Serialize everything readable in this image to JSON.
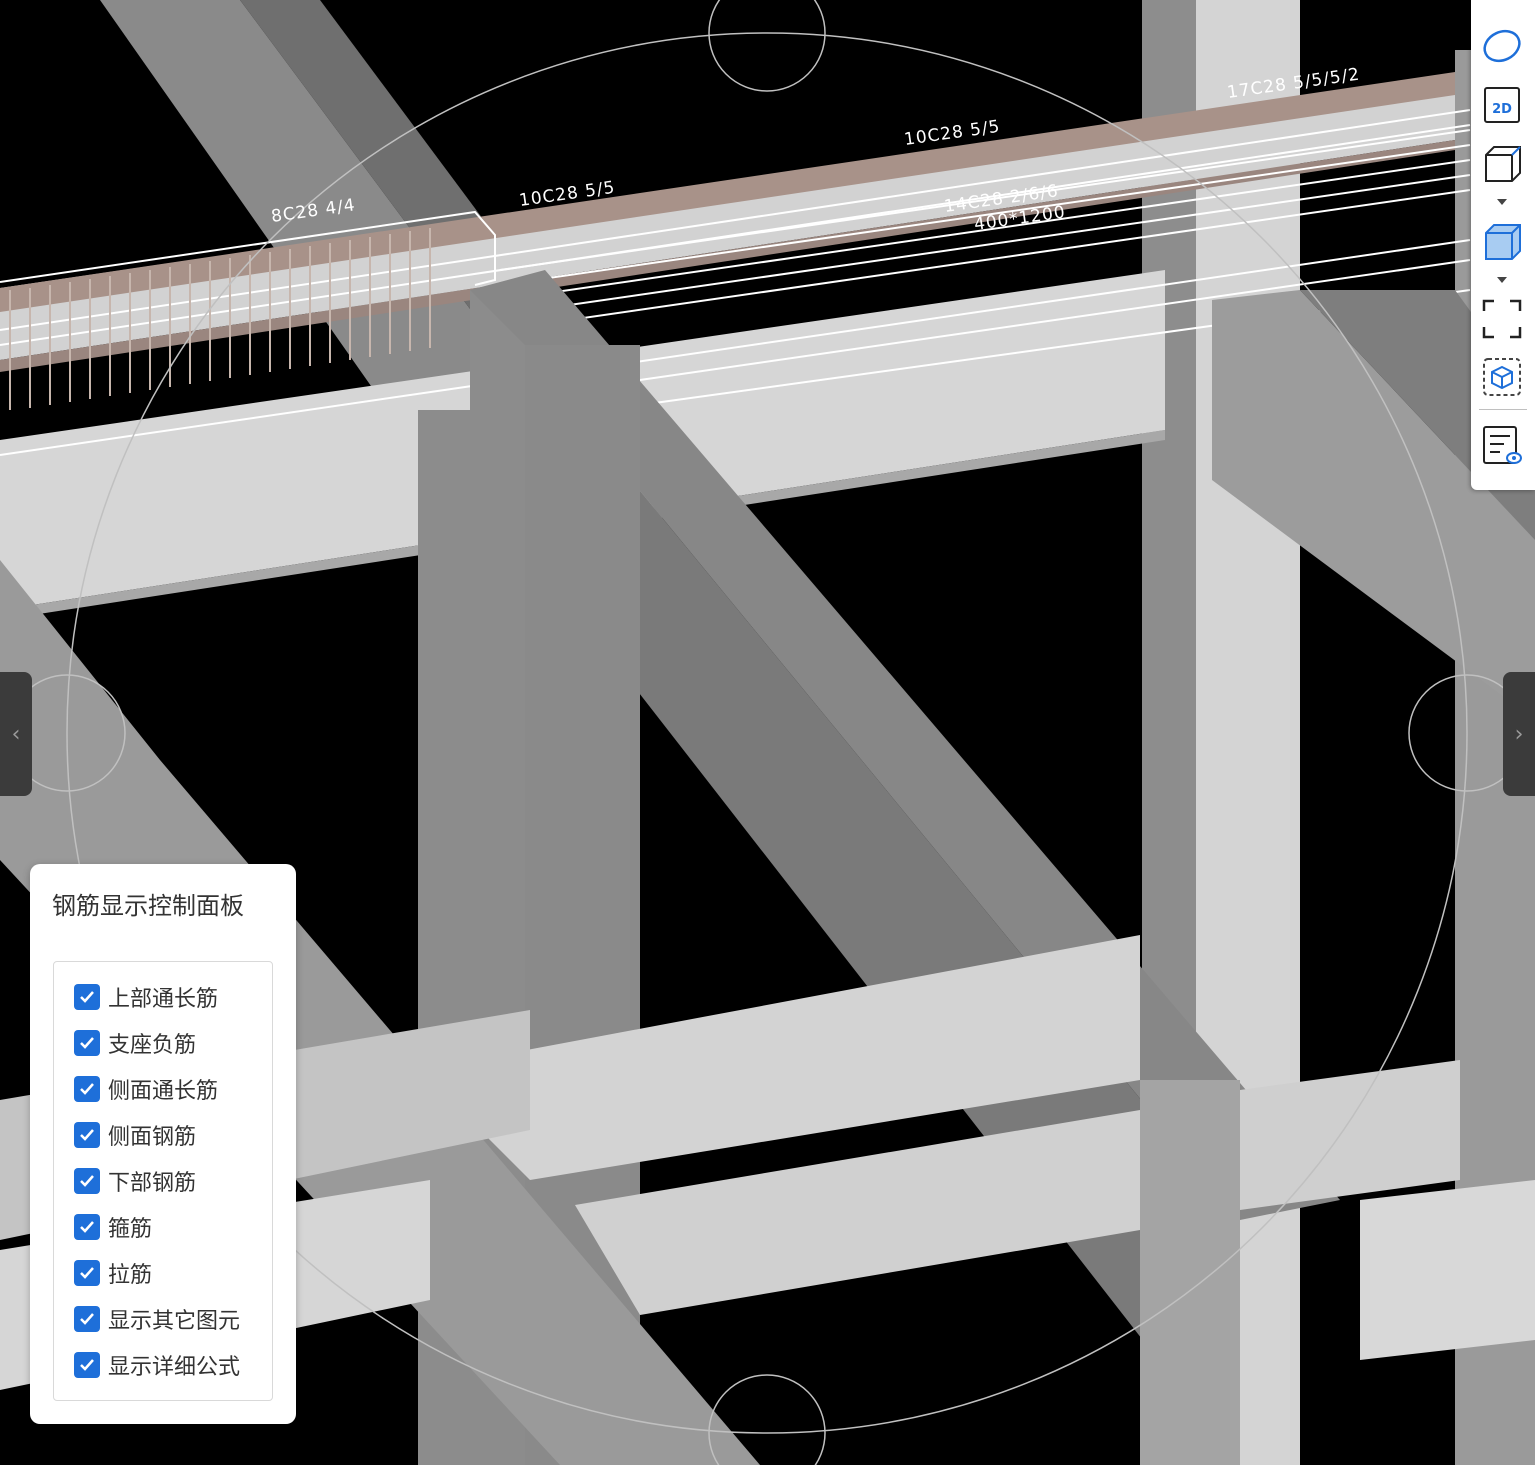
{
  "viewport": {
    "labels": [
      "8C28 4/4",
      "10C28 5/5",
      "10C28 5/5",
      "14C28 2/6/6",
      "400*1200",
      "17C28 5/5/5/2"
    ]
  },
  "panel": {
    "title": "钢筋显示控制面板",
    "options": [
      {
        "label": "上部通长筋",
        "checked": true
      },
      {
        "label": "支座负筋",
        "checked": true
      },
      {
        "label": "侧面通长筋",
        "checked": true
      },
      {
        "label": "侧面钢筋",
        "checked": true
      },
      {
        "label": "下部钢筋",
        "checked": true
      },
      {
        "label": "箍筋",
        "checked": true
      },
      {
        "label": "拉筋",
        "checked": true
      },
      {
        "label": "显示其它图元",
        "checked": true
      },
      {
        "label": "显示详细公式",
        "checked": true
      }
    ]
  },
  "toolbar": {
    "icons": [
      "orbit-icon",
      "2d-view-icon",
      "cube-wireframe-icon",
      "cube-shaded-icon",
      "fit-view-icon",
      "isolate-icon",
      "list-view-icon"
    ],
    "view_2d_text": "2D",
    "accent": "#1e6fd9"
  },
  "nav": {
    "prev_glyph": "‹",
    "next_glyph": "›"
  }
}
